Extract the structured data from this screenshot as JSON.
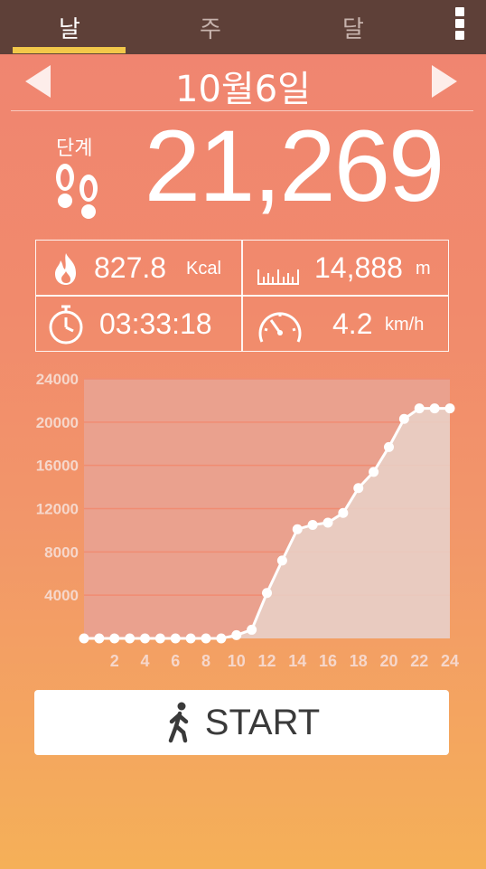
{
  "tabs": [
    {
      "label": "날",
      "active": true
    },
    {
      "label": "주",
      "active": false
    },
    {
      "label": "달",
      "active": false
    }
  ],
  "date": "10월6일",
  "steps": {
    "label": "단계",
    "value": "21,269"
  },
  "stats": {
    "calories": {
      "value": "827.8",
      "unit": "Kcal",
      "icon": "flame-icon"
    },
    "distance": {
      "value": "14,888",
      "unit": "m",
      "icon": "ruler-icon"
    },
    "duration": {
      "value": "03:33:18",
      "icon": "stopwatch-icon"
    },
    "speed": {
      "value": "4.2",
      "unit": "km/h",
      "icon": "speedometer-icon"
    }
  },
  "chart_data": {
    "type": "area",
    "x": [
      0,
      1,
      2,
      3,
      4,
      5,
      6,
      7,
      8,
      9,
      10,
      11,
      12,
      13,
      14,
      15,
      16,
      17,
      18,
      19,
      20,
      21,
      22,
      23,
      24
    ],
    "values": [
      0,
      0,
      0,
      0,
      0,
      0,
      0,
      0,
      0,
      0,
      300,
      800,
      4200,
      7200,
      10100,
      10500,
      10700,
      11600,
      13900,
      15400,
      17700,
      20300,
      21269,
      21269,
      21269
    ],
    "xticks": [
      "2",
      "4",
      "6",
      "8",
      "10",
      "12",
      "14",
      "16",
      "18",
      "20",
      "22",
      "24"
    ],
    "yticks": [
      "4000",
      "8000",
      "12000",
      "16000",
      "20000",
      "24000"
    ],
    "ylim": [
      0,
      24000
    ],
    "xlim": [
      0,
      24
    ],
    "grid": true,
    "colors": {
      "line": "#ffffff",
      "fill": "#e9d2c9",
      "plot_bg": "#eaa18e",
      "grid": "#f08c72",
      "tick": "#f6d7cb"
    }
  },
  "start_button": {
    "label": "START",
    "icon": "walking-person-icon"
  }
}
